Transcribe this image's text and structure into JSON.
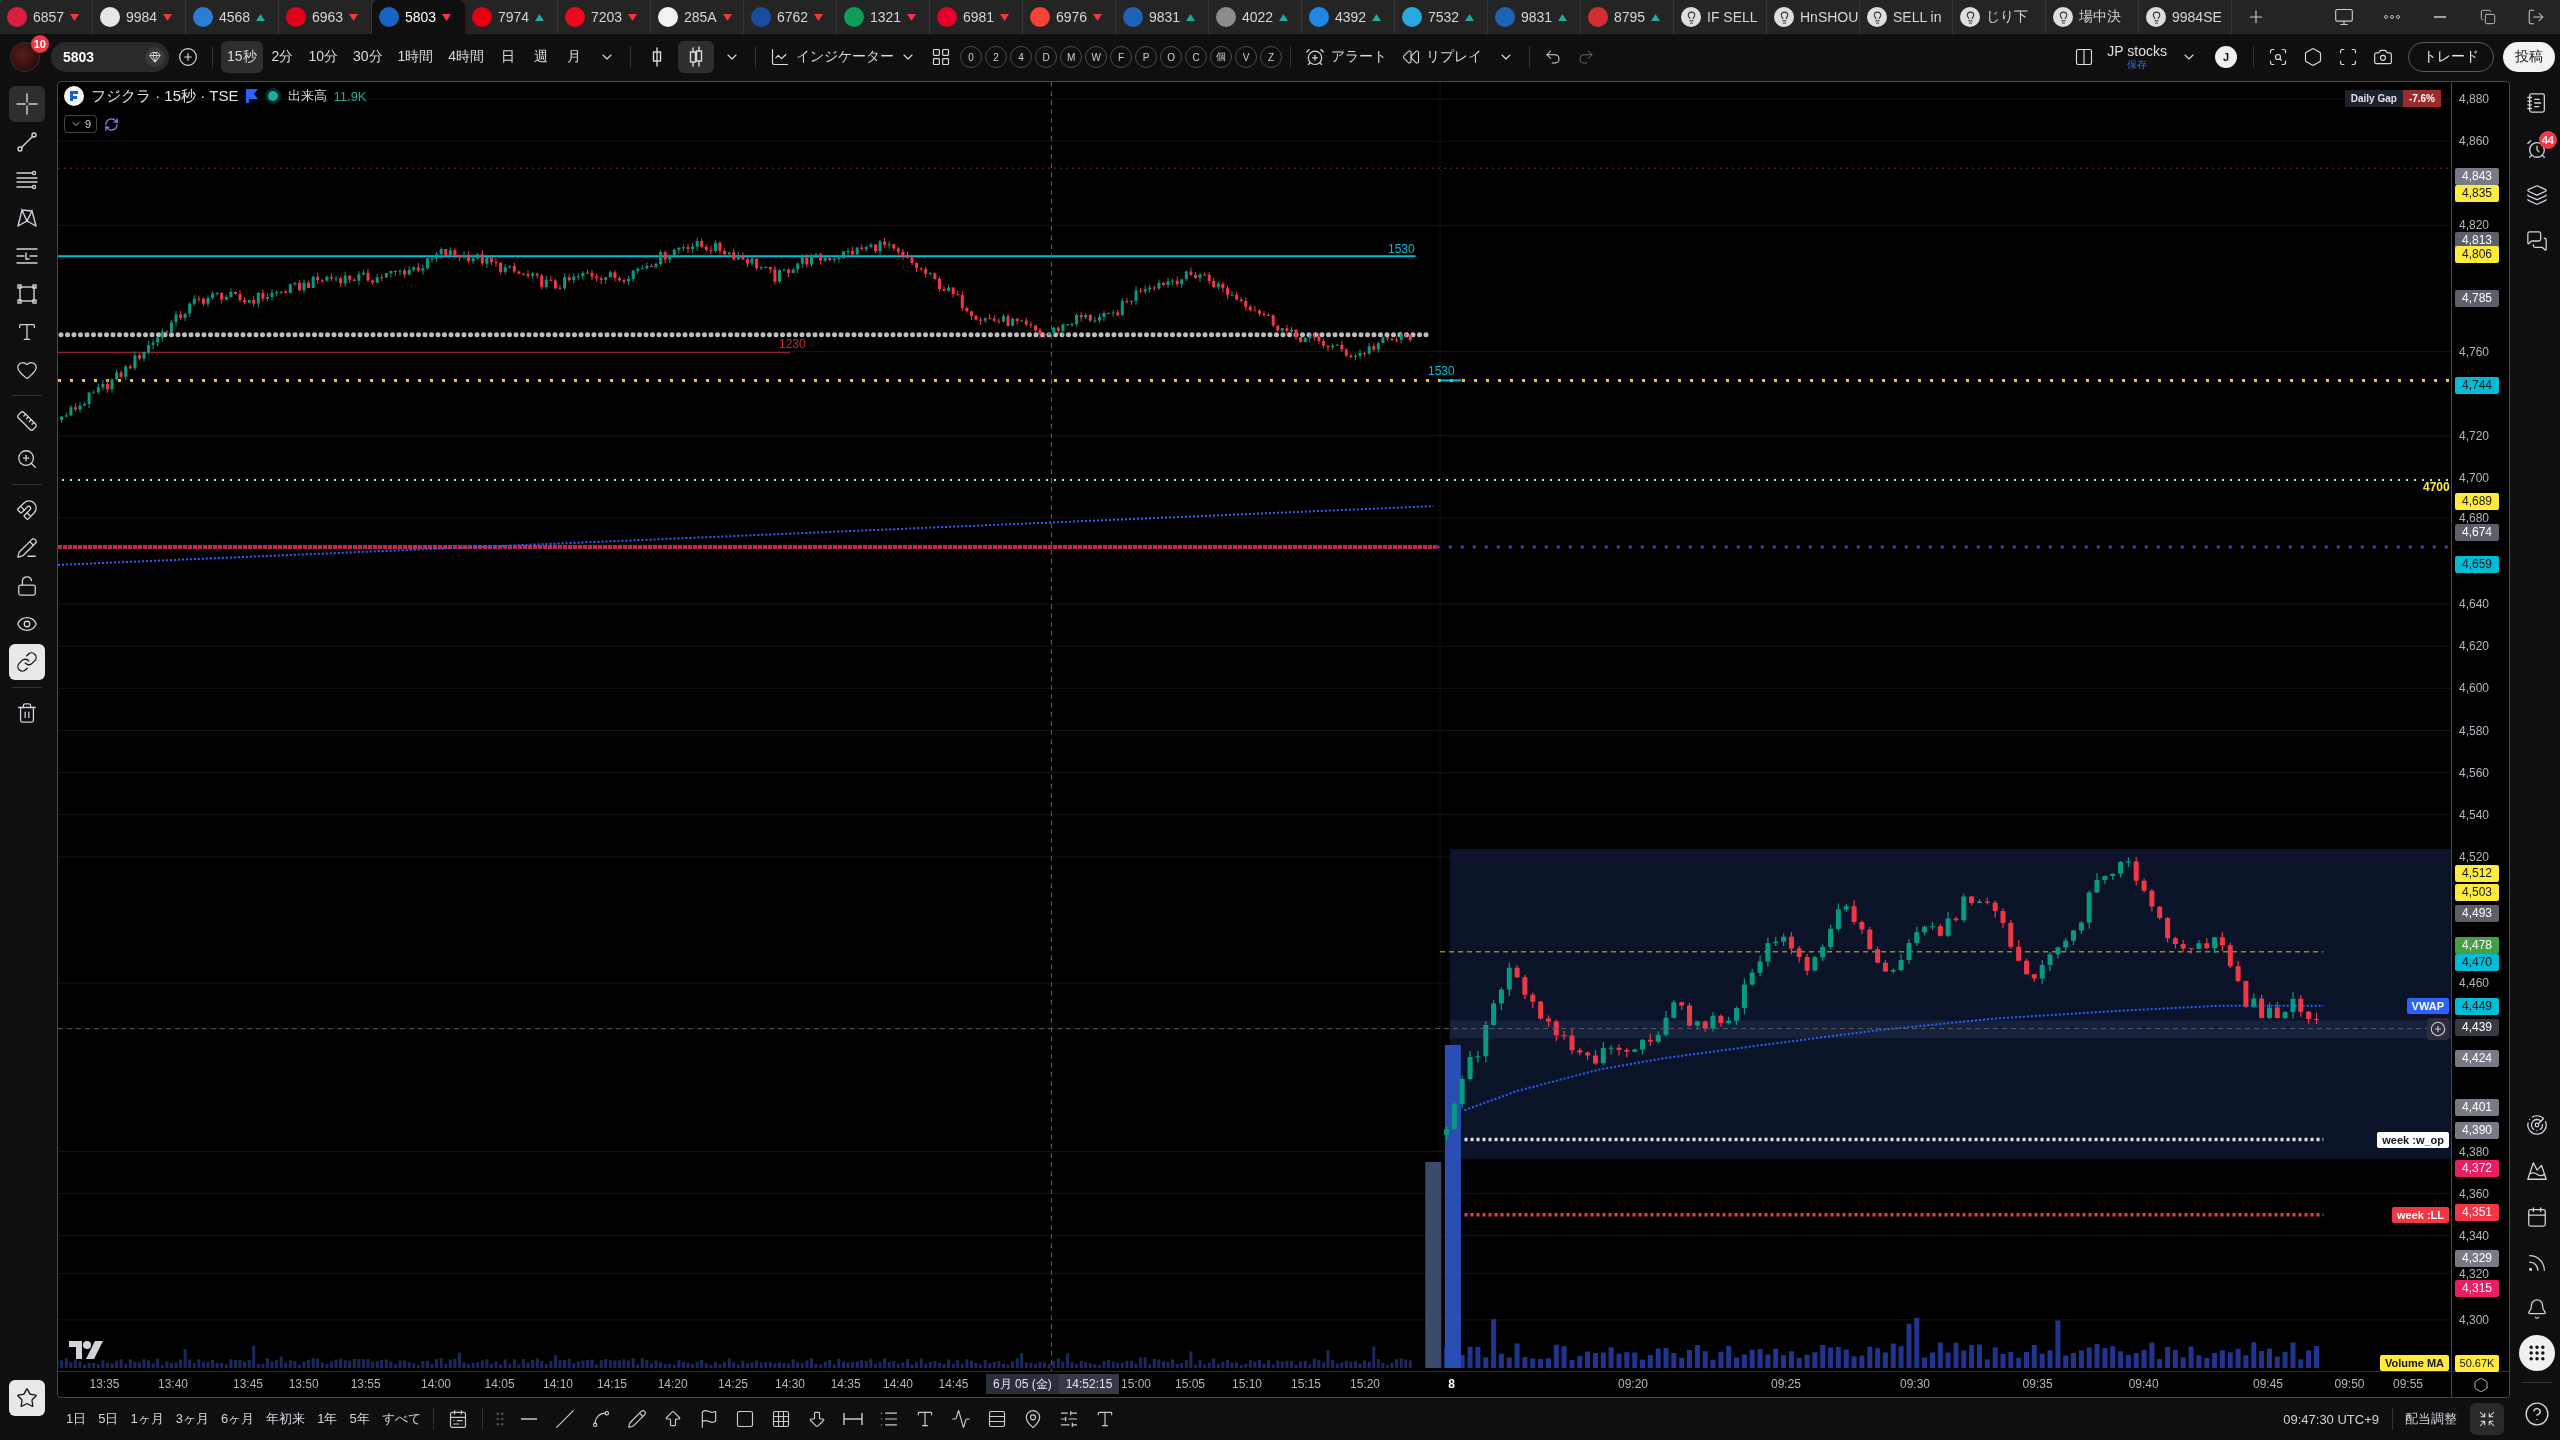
{
  "tabs": [
    {
      "label": "6857",
      "kind": "symbol",
      "color": "#d81e3f",
      "rising": false,
      "selected": false
    },
    {
      "label": "9984",
      "kind": "symbol",
      "color": "#e6e6e6",
      "rising": false,
      "selected": false
    },
    {
      "label": "4568",
      "kind": "symbol",
      "color": "#2b7cd3",
      "rising": true,
      "selected": false
    },
    {
      "label": "6963",
      "kind": "symbol",
      "color": "#e3001b",
      "rising": false,
      "selected": false
    },
    {
      "label": "5803",
      "kind": "symbol",
      "color": "#1565c0",
      "rising": false,
      "selected": true
    },
    {
      "label": "7974",
      "kind": "symbol",
      "color": "#e60012",
      "rising": true,
      "selected": false
    },
    {
      "label": "7203",
      "kind": "symbol",
      "color": "#eb0a1e",
      "rising": false,
      "selected": false
    },
    {
      "label": "285A",
      "kind": "symbol",
      "color": "#f2f2f2",
      "rising": false,
      "selected": false
    },
    {
      "label": "6762",
      "kind": "symbol",
      "color": "#1a4b9c",
      "rising": false,
      "selected": false
    },
    {
      "label": "1321",
      "kind": "symbol",
      "color": "#0f9d58",
      "rising": false,
      "selected": false
    },
    {
      "label": "6981",
      "kind": "symbol",
      "color": "#e4002b",
      "rising": false,
      "selected": false
    },
    {
      "label": "6976",
      "kind": "symbol",
      "color": "#f44336",
      "rising": false,
      "selected": false
    },
    {
      "label": "9831",
      "kind": "symbol",
      "color": "#1e63b5",
      "rising": true,
      "selected": false
    },
    {
      "label": "4022",
      "kind": "symbol",
      "color": "#8c8c8c",
      "rising": true,
      "selected": false
    },
    {
      "label": "4392",
      "kind": "symbol",
      "color": "#1e88e5",
      "rising": true,
      "selected": false
    },
    {
      "label": "7532",
      "kind": "symbol",
      "color": "#29a8e0",
      "rising": true,
      "selected": false
    },
    {
      "label": "9831",
      "kind": "symbol",
      "color": "#1e63b5",
      "rising": true,
      "selected": false
    },
    {
      "label": "8795",
      "kind": "symbol",
      "color": "#d32f2f",
      "rising": true,
      "selected": false
    },
    {
      "label": "IF SELL",
      "kind": "list",
      "selected": false
    },
    {
      "label": "HnSHOU",
      "kind": "list",
      "selected": false
    },
    {
      "label": "SELL in",
      "kind": "list",
      "selected": false
    },
    {
      "label": "じり下",
      "kind": "list",
      "selected": false
    },
    {
      "label": "場中決",
      "kind": "list",
      "selected": false
    },
    {
      "label": "9984SE",
      "kind": "list",
      "selected": false
    }
  ],
  "toolbar": {
    "notification_count": "10",
    "symbol": "5803",
    "intervals": [
      {
        "label": "15秒",
        "selected": true
      },
      {
        "label": "2分",
        "selected": false
      },
      {
        "label": "10分",
        "selected": false
      },
      {
        "label": "30分",
        "selected": false
      },
      {
        "label": "1時間",
        "selected": false
      },
      {
        "label": "4時間",
        "selected": false
      },
      {
        "label": "日",
        "selected": false
      },
      {
        "label": "週",
        "selected": false
      },
      {
        "label": "月",
        "selected": false
      }
    ],
    "chart_types": [
      {
        "selected": false
      },
      {
        "selected": true
      }
    ],
    "indicators": "インジケーター",
    "quick_buttons": [
      "0",
      "2",
      "4",
      "D",
      "M",
      "W",
      "F",
      "P",
      "O",
      "C",
      "個",
      "V",
      "Z"
    ],
    "alert": "アラート",
    "replay": "リプレイ",
    "layout_name": "JP stocks",
    "layout_status": "保存",
    "user_initial": "J",
    "trade": "トレード",
    "publish": "投稿"
  },
  "left_toolbar": {
    "tools": [
      {
        "selected": true
      },
      {
        "selected": false
      },
      {
        "selected": false
      },
      {
        "selected": false
      },
      {
        "selected": false
      },
      {
        "selected": false
      },
      {
        "selected": false
      },
      {
        "selected": false
      },
      {
        "selected": false
      },
      {
        "selected": false
      }
    ],
    "toggles": [
      {
        "on": false
      },
      {
        "on": false
      },
      {
        "on": false
      },
      {
        "on": false
      },
      {
        "on": true
      }
    ],
    "favorites_on": true
  },
  "legend": {
    "title": "フジクラ · 15秒 · TSE",
    "flagged": true,
    "market_open": true,
    "volume_label": "出来高",
    "volume_value": "11.9K",
    "hidden_count": "9"
  },
  "daily_gap": {
    "label": "Daily Gap",
    "value": "-7.6%"
  },
  "line_labels": [
    {
      "text": "1530",
      "color": "#00bcd4"
    },
    {
      "text": "1230",
      "color": "#c62835"
    },
    {
      "text": "1530",
      "color": "#00bcd4"
    },
    {
      "text": "4700",
      "color": "#ffeb3b"
    }
  ],
  "series_labels": [
    {
      "text": "VWAP",
      "color": "#2962ff"
    },
    {
      "text": "week :w_op",
      "color": "#ffffff"
    },
    {
      "text": "week :LL",
      "color": "#f23645"
    },
    {
      "text": "Volume MA",
      "color": "#ffeb3b"
    }
  ],
  "price_axis": {
    "ticks": [
      "4,880",
      "4,860",
      "4,820",
      "4,760",
      "4,720",
      "4,700",
      "4,680",
      "4,640",
      "4,620",
      "4,600",
      "4,580",
      "4,560",
      "4,540",
      "4,520",
      "4,460",
      "4,380",
      "4,360",
      "4,340",
      "4,320",
      "4,300"
    ],
    "tags": [
      {
        "text": "4,843",
        "color": "#787b86"
      },
      {
        "text": "4,835",
        "color": "#ffeb3b"
      },
      {
        "text": "4,813",
        "color": "#5d606b"
      },
      {
        "text": "4,806",
        "color": "#ffeb3b"
      },
      {
        "text": "4,785",
        "color": "#5d606b"
      },
      {
        "text": "4,744",
        "color": "#00bcd4"
      },
      {
        "text": "4,689",
        "color": "#ffeb3b"
      },
      {
        "text": "4,674",
        "color": "#5d606b"
      },
      {
        "text": "4,659",
        "color": "#00bcd4"
      },
      {
        "text": "4,512",
        "color": "#ffeb3b"
      },
      {
        "text": "4,503",
        "color": "#ffeb3b"
      },
      {
        "text": "4,493",
        "color": "#5d606b"
      },
      {
        "text": "4,478",
        "color": "#43a047"
      },
      {
        "text": "4,470",
        "color": "#00bcd4"
      },
      {
        "text": "4,449",
        "color": "#00bcd4"
      },
      {
        "text": "4,439",
        "color": "#363a45"
      },
      {
        "text": "4,424",
        "color": "#787b86"
      },
      {
        "text": "4,401",
        "color": "#787b86"
      },
      {
        "text": "4,390",
        "color": "#787b86"
      },
      {
        "text": "4,372",
        "color": "#e91e63"
      },
      {
        "text": "4,351",
        "color": "#f23645"
      },
      {
        "text": "4,329",
        "color": "#787b86"
      },
      {
        "text": "4,315",
        "color": "#e91e63"
      }
    ],
    "volume_ma_value": "50.67K"
  },
  "time_axis": {
    "ticks": [
      {
        "label": "13:35",
        "kind": "time"
      },
      {
        "label": "13:40",
        "kind": "time"
      },
      {
        "label": "13:45",
        "kind": "time"
      },
      {
        "label": "13:50",
        "kind": "time"
      },
      {
        "label": "13:55",
        "kind": "time"
      },
      {
        "label": "14:00",
        "kind": "time"
      },
      {
        "label": "14:05",
        "kind": "time"
      },
      {
        "label": "14:10",
        "kind": "time"
      },
      {
        "label": "14:15",
        "kind": "time"
      },
      {
        "label": "14:20",
        "kind": "time"
      },
      {
        "label": "14:25",
        "kind": "time"
      },
      {
        "label": "14:30",
        "kind": "time"
      },
      {
        "label": "14:35",
        "kind": "time"
      },
      {
        "label": "14:40",
        "kind": "time"
      },
      {
        "label": "14:45",
        "kind": "time"
      },
      {
        "label": "15:00",
        "kind": "time"
      },
      {
        "label": "15:05",
        "kind": "time"
      },
      {
        "label": "15:10",
        "kind": "time"
      },
      {
        "label": "15:15",
        "kind": "time"
      },
      {
        "label": "15:20",
        "kind": "time"
      },
      {
        "label": "8",
        "kind": "day"
      },
      {
        "label": "09:20",
        "kind": "time"
      },
      {
        "label": "09:25",
        "kind": "time"
      },
      {
        "label": "09:30",
        "kind": "time"
      },
      {
        "label": "09:35",
        "kind": "time"
      },
      {
        "label": "09:40",
        "kind": "time"
      },
      {
        "label": "09:45",
        "kind": "time"
      },
      {
        "label": "09:50",
        "kind": "time"
      },
      {
        "label": "09:55",
        "kind": "time"
      }
    ],
    "crosshair_date": "6月 05 (金)",
    "crosshair_time": "14:52:15"
  },
  "right_sidebar": {
    "alerts_badge": "44"
  },
  "bottom_bar": {
    "ranges": [
      "1日",
      "5日",
      "1ヶ月",
      "3ヶ月",
      "6ヶ月",
      "年初来",
      "1年",
      "5年",
      "すべて"
    ],
    "clock": "09:47:30 UTC+9",
    "adjust": "配当調整"
  }
}
